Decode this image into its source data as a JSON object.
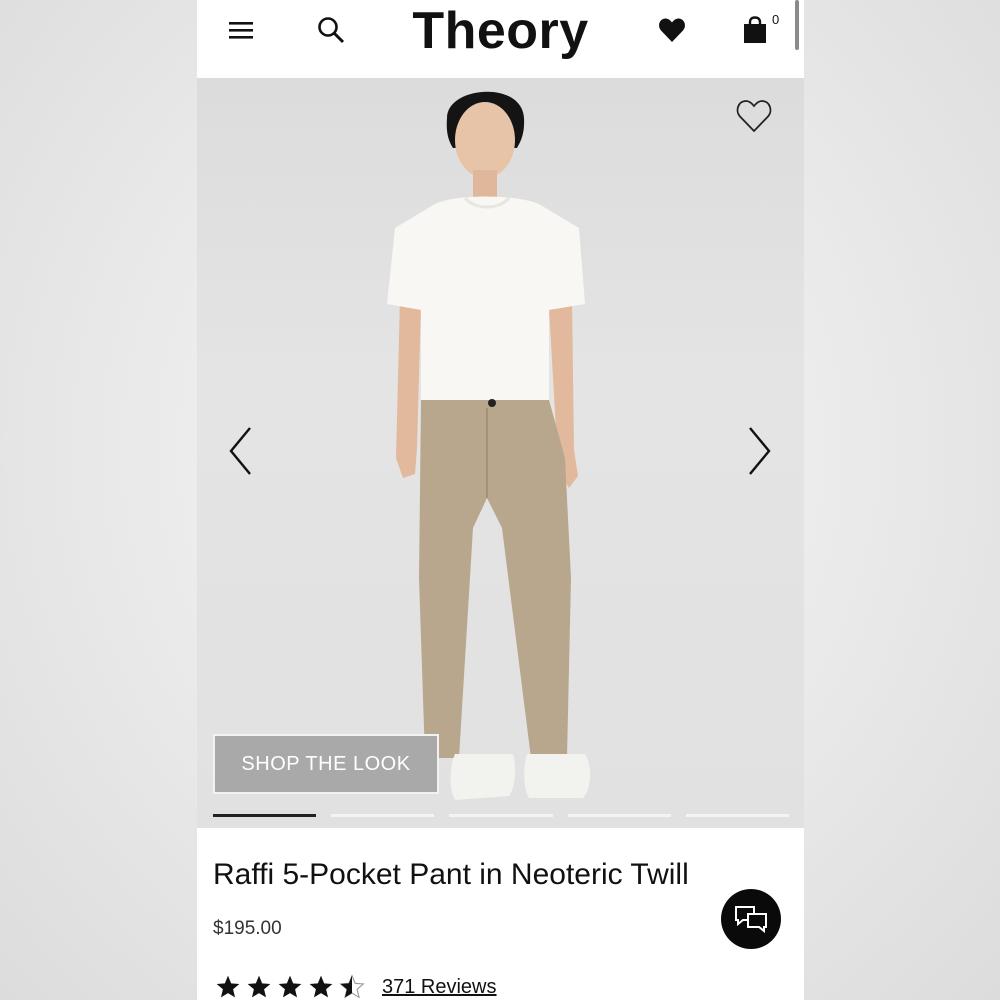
{
  "header": {
    "brand": "Theory",
    "bag_count": "0",
    "icons": [
      "menu-icon",
      "search-icon",
      "heart-icon",
      "shopping-bag-icon"
    ]
  },
  "gallery": {
    "shop_the_look_label": "SHOP THE LOOK",
    "slide_count": 5,
    "active_slide": 1
  },
  "product": {
    "title": "Raffi 5-Pocket Pant in Neoteric Twill",
    "price": "$195.00",
    "rating": 4.5,
    "reviews_label": "371 Reviews"
  },
  "colors": {
    "background": "#ffffff",
    "text": "#111111",
    "accent": "#000000"
  }
}
